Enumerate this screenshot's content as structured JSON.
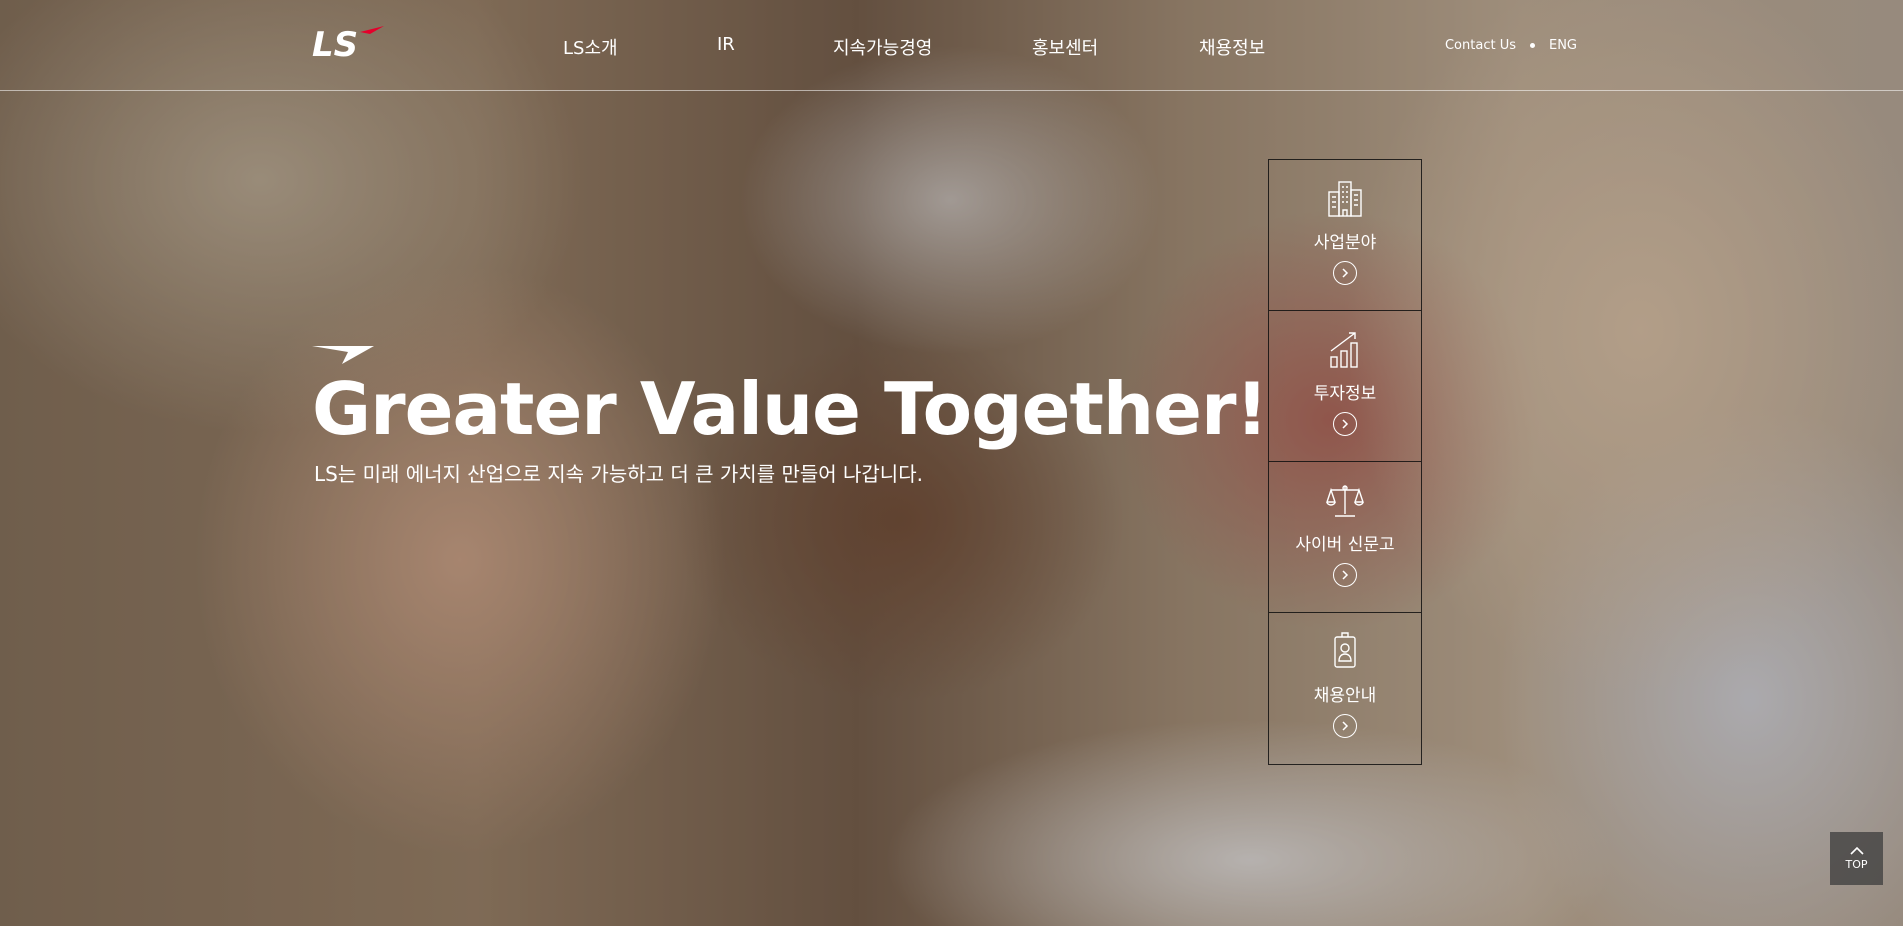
{
  "header": {
    "logo_text": "LS",
    "nav": [
      "LS소개",
      "IR",
      "지속가능경영",
      "홍보센터",
      "채용정보"
    ],
    "util": {
      "contact": "Contact Us",
      "lang": "ENG"
    }
  },
  "visual": {
    "headline": "Greater Value Together!",
    "subcopy": "LS는 미래 에너지 산업으로 지속 가능하고 더 큰 가치를 만들어 나갑니다."
  },
  "quick_menu": [
    {
      "label": "사업분야",
      "icon": "building-icon"
    },
    {
      "label": "투자정보",
      "icon": "chart-growth-icon"
    },
    {
      "label": "사이버 신문고",
      "icon": "scales-icon"
    },
    {
      "label": "채용안내",
      "icon": "id-badge-icon"
    }
  ],
  "top_button": {
    "label": "TOP"
  },
  "colors": {
    "brand_red": "#e4002b",
    "text": "#ffffff"
  }
}
